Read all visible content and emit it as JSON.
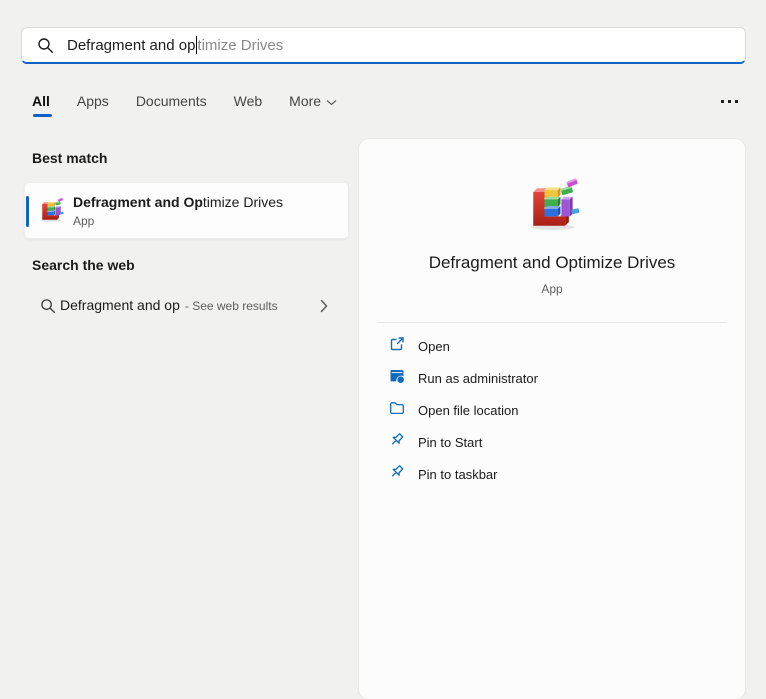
{
  "search_box": {
    "typed": "Defragment and op",
    "suggestion": "timize Drives"
  },
  "tabs": {
    "items": [
      {
        "label": "All"
      },
      {
        "label": "Apps"
      },
      {
        "label": "Documents"
      },
      {
        "label": "Web"
      },
      {
        "label": "More"
      }
    ],
    "selected": "All"
  },
  "sections": {
    "best_match": "Best match",
    "search_web": "Search the web"
  },
  "best_match_item": {
    "title_match": "Defragment and Op",
    "title_rest": "timize Drives",
    "type": "App"
  },
  "web_suggestion": {
    "query": "Defragment and op",
    "hint": "- See web results"
  },
  "preview": {
    "title": "Defragment and Optimize Drives",
    "type": "App",
    "actions": [
      {
        "label": "Open",
        "icon": "open-external-icon"
      },
      {
        "label": "Run as administrator",
        "icon": "run-as-admin-icon"
      },
      {
        "label": "Open file location",
        "icon": "folder-icon"
      },
      {
        "label": "Pin to Start",
        "icon": "pin-icon"
      },
      {
        "label": "Pin to taskbar",
        "icon": "pin-icon"
      }
    ]
  },
  "colors": {
    "accent": "#1063c5",
    "action_icon": "#0f6cbd"
  }
}
